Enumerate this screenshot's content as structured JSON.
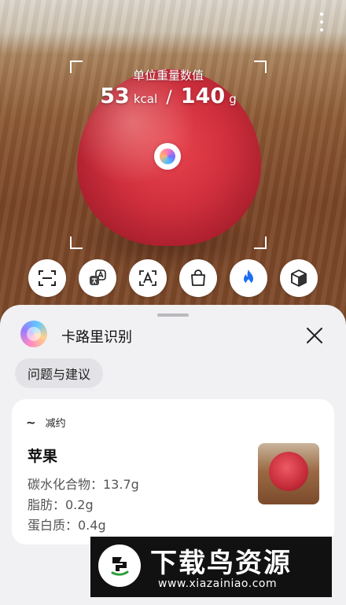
{
  "overlay": {
    "unit_title": "单位重量数值",
    "calories_value": "53",
    "calories_unit": "kcal",
    "separator": "/",
    "weight_value": "140",
    "weight_unit": "g"
  },
  "modes": [
    {
      "icon": "scan-icon",
      "selected": false
    },
    {
      "icon": "translate-icon",
      "selected": false
    },
    {
      "icon": "text-recognition-icon",
      "selected": false
    },
    {
      "icon": "shopping-bag-icon",
      "selected": false
    },
    {
      "icon": "flame-icon",
      "selected": true
    },
    {
      "icon": "box-icon",
      "selected": false
    }
  ],
  "sheet": {
    "title": "卡路里识别",
    "feedback_label": "问题与建议",
    "card": {
      "tag": "减约",
      "food_name": "苹果",
      "nutrients": [
        "碳水化合物：13.7g",
        "脂肪：0.2g",
        "蛋白质：0.4g"
      ]
    }
  },
  "watermark": {
    "title": "下载鸟资源",
    "url": "www.xiazainiao.com"
  },
  "colors": {
    "accent": "#1c6ef2",
    "sheet_bg": "#f1f0f3",
    "chip_bg": "#e3e2e6"
  }
}
